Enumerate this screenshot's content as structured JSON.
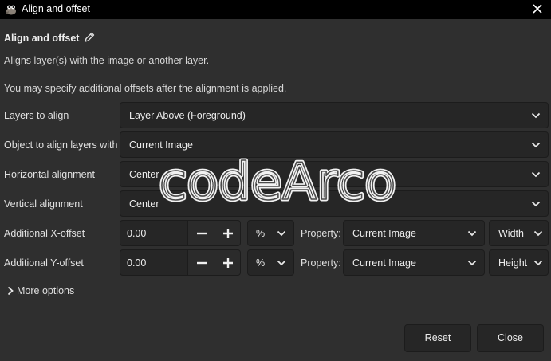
{
  "window": {
    "title": "Align and offset",
    "icon": "gimp-wilber-icon"
  },
  "dialog": {
    "heading": "Align and offset",
    "description": "Aligns layer(s) with the image or another layer.",
    "note": "You may specify additional offsets after the alignment is applied."
  },
  "fields": {
    "layers_to_align": {
      "label": "Layers to align",
      "value": "Layer Above (Foreground)"
    },
    "object_to_align_with": {
      "label": "Object to align layers with",
      "value": "Current Image"
    },
    "horizontal_alignment": {
      "label": "Horizontal alignment",
      "value": "Center"
    },
    "vertical_alignment": {
      "label": "Vertical alignment",
      "value": "Center"
    },
    "x_offset": {
      "label": "Additional X-offset",
      "value": "0.00",
      "unit": "%",
      "property_label": "Property:",
      "property_value": "Current Image",
      "dimension": "Width"
    },
    "y_offset": {
      "label": "Additional Y-offset",
      "value": "0.00",
      "unit": "%",
      "property_label": "Property:",
      "property_value": "Current Image",
      "dimension": "Height"
    }
  },
  "more_options": "More options",
  "buttons": {
    "reset": "Reset",
    "close": "Close"
  },
  "watermark": "codeArco"
}
